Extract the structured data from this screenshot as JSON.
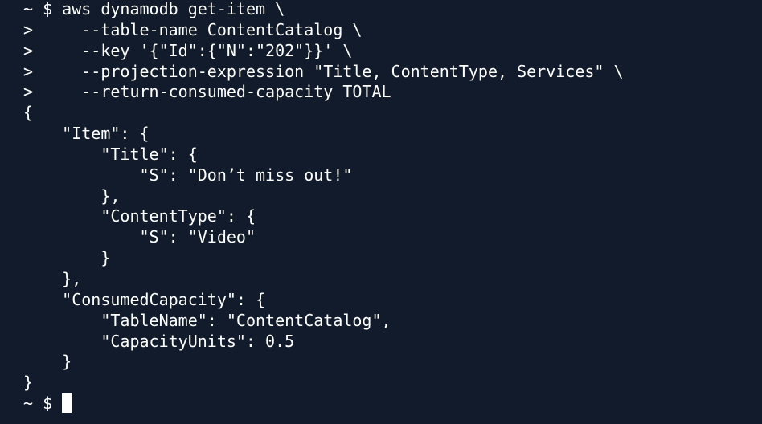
{
  "terminal": {
    "lines": [
      "~ $ aws dynamodb get-item \\",
      ">     --table-name ContentCatalog \\",
      ">     --key '{\"Id\":{\"N\":\"202\"}}' \\",
      ">     --projection-expression \"Title, ContentType, Services\" \\",
      ">     --return-consumed-capacity TOTAL",
      "{",
      "    \"Item\": {",
      "        \"Title\": {",
      "            \"S\": \"Don’t miss out!\"",
      "        },",
      "        \"ContentType\": {",
      "            \"S\": \"Video\"",
      "        }",
      "    },",
      "    \"ConsumedCapacity\": {",
      "        \"TableName\": \"ContentCatalog\",",
      "        \"CapacityUnits\": 0.5",
      "    }",
      "}"
    ],
    "prompt": "~ $ ",
    "colors": {
      "background": "#111b2b",
      "foreground": "#ffffff",
      "cursor": "#ffffff"
    }
  }
}
